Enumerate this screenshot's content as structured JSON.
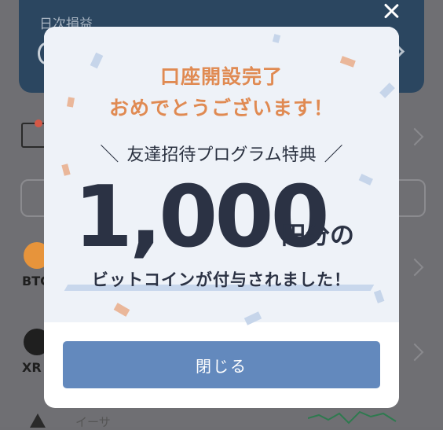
{
  "background": {
    "daily_pnl_label": "日次損益",
    "coins": [
      {
        "symbol": "BTC",
        "label_visible": "BTC"
      },
      {
        "symbol": "XRP",
        "label_visible": "XR"
      }
    ],
    "eth_label": "イーサ"
  },
  "modal": {
    "title_line1": "口座開設完了",
    "title_line2": "おめでとうございます！",
    "program_label": "友達招待プログラム特典",
    "slash_left": "＼",
    "slash_right": "／",
    "amount": "1,000",
    "amount_suffix": "円分の",
    "bonus_text": "ビットコインが付与されました！",
    "close_button_label": "閉じる"
  },
  "colors": {
    "accent_orange": "#e08a52",
    "primary_button": "#6389bd",
    "amount_text": "#2b3244",
    "modal_top_bg": "#eef2f8"
  },
  "icons": {
    "close": "close-icon"
  }
}
